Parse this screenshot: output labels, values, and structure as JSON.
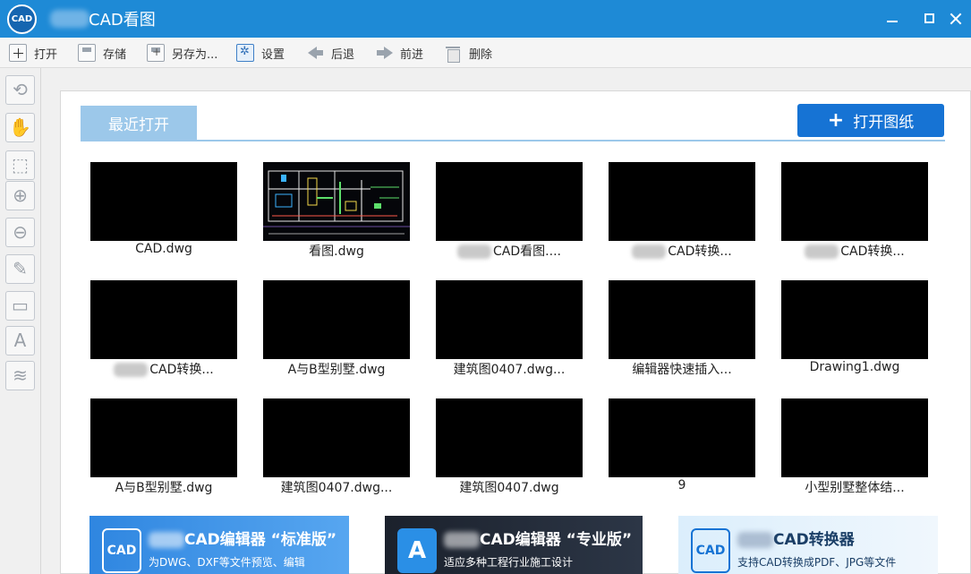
{
  "window": {
    "logo_text": "CAD",
    "title": "CAD看图"
  },
  "toolbar": {
    "open": "打开",
    "save": "存储",
    "save_as": "另存为...",
    "settings": "设置",
    "back": "后退",
    "forward": "前进",
    "delete": "删除"
  },
  "sidebar": {
    "tools": [
      "rotate-icon",
      "pan-hand-icon",
      "zoom-window-icon",
      "zoom-in-icon",
      "zoom-out-icon",
      "pencil-icon",
      "measure-icon",
      "text-icon",
      "layers-icon"
    ]
  },
  "main": {
    "tab_recent": "最近打开",
    "open_drawing_button": "打开图纸",
    "files": [
      {
        "name": "CAD.dwg",
        "blurred_prefix": false
      },
      {
        "name": "看图.dwg",
        "blurred_prefix": false
      },
      {
        "name": "CAD看图....",
        "blurred_prefix": true
      },
      {
        "name": "CAD转换...",
        "blurred_prefix": true
      },
      {
        "name": "CAD转换...",
        "blurred_prefix": true
      },
      {
        "name": "CAD转换...",
        "blurred_prefix": true
      },
      {
        "name": "A与B型别墅.dwg",
        "blurred_prefix": false
      },
      {
        "name": "建筑图0407.dwg...",
        "blurred_prefix": false
      },
      {
        "name": "编辑器快速插入...",
        "blurred_prefix": false
      },
      {
        "name": "Drawing1.dwg",
        "blurred_prefix": false
      },
      {
        "name": "A与B型别墅.dwg",
        "blurred_prefix": false
      },
      {
        "name": "建筑图0407.dwg...",
        "blurred_prefix": false
      },
      {
        "name": "建筑图0407.dwg",
        "blurred_prefix": false
      },
      {
        "name": "9",
        "blurred_prefix": false
      },
      {
        "name": "小型别墅整体结...",
        "blurred_prefix": false
      }
    ]
  },
  "banners": [
    {
      "title": "CAD编辑器 “标准版”",
      "subtitle": "为DWG、DXF等文件预览、编辑",
      "logo": "CAD",
      "color": "#2f86e0"
    },
    {
      "title": "CAD编辑器 “专业版”",
      "subtitle": "适应多种工程行业施工设计",
      "logo": "A",
      "color": "#222a36"
    },
    {
      "title": "CAD转换器",
      "subtitle": "支持CAD转换成PDF、JPG等文件",
      "logo": "CAD",
      "color": "#2a8fe6"
    }
  ]
}
